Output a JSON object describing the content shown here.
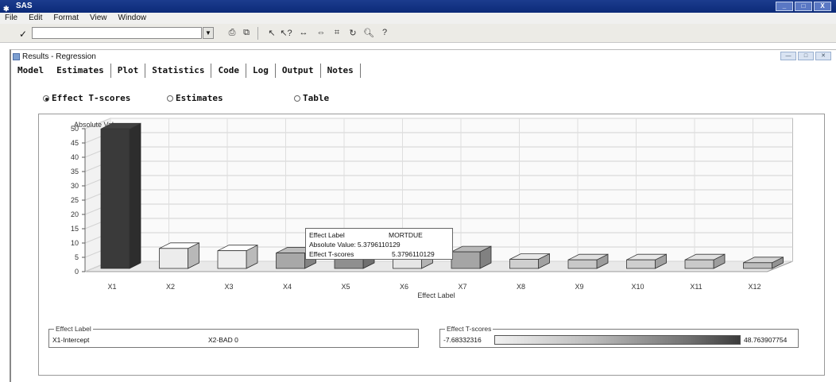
{
  "app": {
    "title": "SAS",
    "icon": "sas-icon"
  },
  "menu": [
    "File",
    "Edit",
    "Format",
    "View",
    "Window"
  ],
  "toolbar": {
    "check": "✓",
    "command_value": ""
  },
  "window": {
    "title": "Results - Regression"
  },
  "tabs": [
    "Model",
    "Estimates",
    "Plot",
    "Statistics",
    "Code",
    "Log",
    "Output",
    "Notes"
  ],
  "radios": {
    "t_scores": "Effect T-scores",
    "estimates": "Estimates",
    "table": "Table",
    "selected": "t_scores"
  },
  "chart_data": {
    "type": "bar",
    "ylabel": "Absolute Value",
    "xlabel": "Effect Label",
    "ylim": [
      0,
      50
    ],
    "yticks": [
      0,
      5,
      10,
      15,
      20,
      25,
      30,
      35,
      40,
      45,
      50
    ],
    "categories": [
      "X1",
      "X2",
      "X3",
      "X4",
      "X5",
      "X6",
      "X7",
      "X8",
      "X9",
      "X10",
      "X11",
      "X12"
    ],
    "values": [
      48.8,
      7.0,
      6.2,
      5.4,
      5.3796,
      5.8,
      5.8,
      3.2,
      3.0,
      3.0,
      3.0,
      2.0
    ],
    "colors": [
      "#3a3a3a",
      "#ececec",
      "#efefef",
      "#a8a8a8",
      "#8f8f8f",
      "#e6e6e6",
      "#a5a5a5",
      "#cfcfcf",
      "#c8c8c8",
      "#cfcfcf",
      "#c9c9c9",
      "#bdbdbd"
    ],
    "grid": true
  },
  "tooltip": {
    "label_key": "Effect Label",
    "label_val": "MORTDUE",
    "abs_key": "Absolute Value:",
    "abs_val": "5.3796110129",
    "t_key": "Effect T-scores",
    "t_val": "5.3796110129"
  },
  "legend_effect": {
    "caption": "Effect Label",
    "item1": "X1-Intercept",
    "item2": "X2-BAD 0"
  },
  "legend_tscores": {
    "caption": "Effect T-scores",
    "min": "-7.68332316",
    "max": "48.763907754"
  }
}
